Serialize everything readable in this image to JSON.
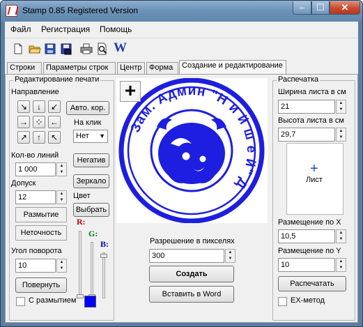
{
  "window": {
    "title": "Stamp 0.85 Registered Version",
    "controls": {
      "minimize": "–",
      "maximize": "☐",
      "close": "✕"
    }
  },
  "menu": [
    "Файл",
    "Регистрация",
    "Помощь"
  ],
  "toolbar": {
    "icons": [
      "new-file-icon",
      "open-folder-icon",
      "save-icon",
      "save-as-icon",
      "print-icon",
      "print-preview-icon",
      "word-icon"
    ],
    "word_label": "W"
  },
  "tabs": [
    {
      "label": "Строки",
      "active": false
    },
    {
      "label": "Параметры строк",
      "active": false
    },
    {
      "label": "Центр",
      "active": false
    },
    {
      "label": "Форма",
      "active": false
    },
    {
      "label": "Создание и редактирование",
      "active": true
    }
  ],
  "edit": {
    "title": "Редактирование печати",
    "direction_label": "Направление",
    "arrows": [
      "↘",
      "↓",
      "↙",
      "→",
      "⁘",
      "←",
      "↗",
      "↑",
      "↖"
    ],
    "auto_cor": "Авто. кор.",
    "on_click_label": "На клик",
    "on_click_value": "Нет",
    "lines_count_label": "Кол-во линий",
    "lines_count_value": "1 000",
    "negative_button": "Негатив",
    "tolerance_label": "Допуск",
    "tolerance_value": "12",
    "mirror_button": "Зеркало",
    "color_label": "Цвет",
    "blur_button": "Размытие",
    "choose_button": "Выбрать",
    "sharpness_button": "Неточность",
    "rotation_label": "Угол поворота",
    "rotation_value": "10",
    "rotate_button": "Повернуть",
    "with_blur_label": "С размытием",
    "rgb": {
      "r": "R:",
      "g": "G:",
      "b": "B:"
    },
    "color_swatch": "#0000ff",
    "channel_colors": {
      "r": "#c00000",
      "g": "#008000",
      "b": "#0000c0"
    }
  },
  "preview": {
    "stamp_text": "Зам. Админ \"Н и й ш е й\" Д",
    "stamp_color": "#1e1ee0",
    "plus_icon": "+",
    "resolution_label": "Разрешение в пикселях",
    "resolution_value": "300",
    "create_button": "Создать",
    "insert_word_button": "Вставить в Word"
  },
  "print": {
    "title": "Распечатка",
    "sheet_width_label": "Ширина листа в см",
    "sheet_width_value": "21",
    "sheet_height_label": "Высота листа в см",
    "sheet_height_value": "29,7",
    "sheet_label": "Лист",
    "place_x_label": "Размещение по X",
    "place_x_value": "10,5",
    "place_y_label": "Размещение по Y",
    "place_y_value": "10",
    "print_button": "Распечатать",
    "ex_method_label": "EX-метод"
  }
}
